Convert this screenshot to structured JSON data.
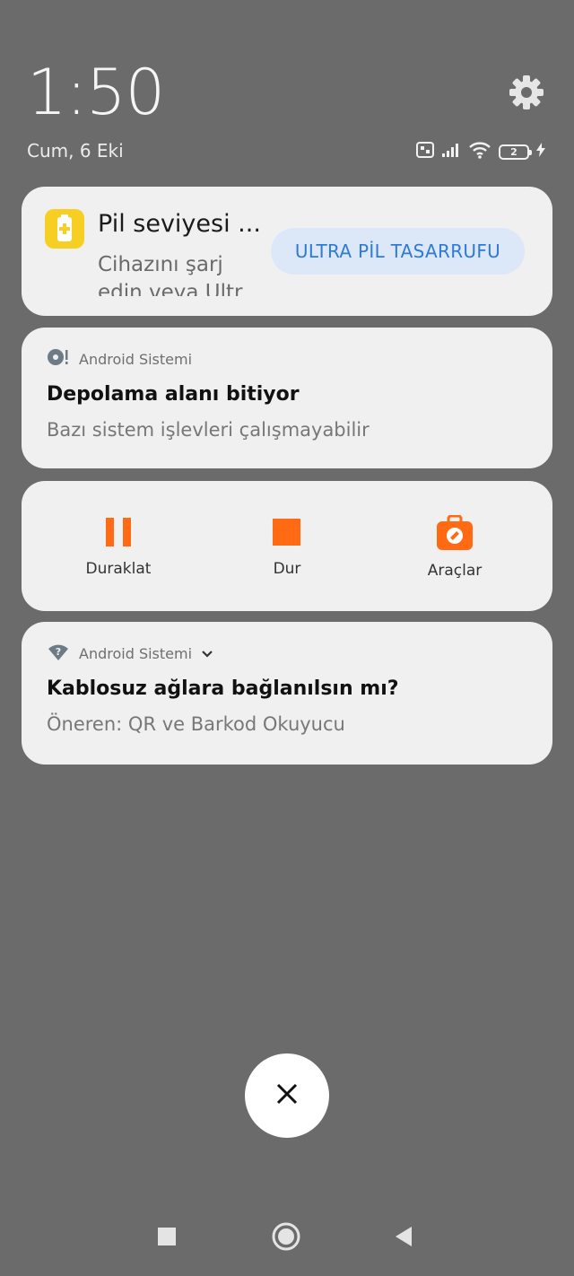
{
  "status": {
    "time": "1:50",
    "date": "Cum, 6 Eki",
    "battery_level": "2",
    "icons": [
      "volte-icon",
      "signal-icon",
      "wifi-icon",
      "battery-icon",
      "charging-icon"
    ]
  },
  "notifications": {
    "battery": {
      "title": "Pil seviyesi ...",
      "body": "Cihazını şarj edin veya Ultr",
      "action": "ULTRA PİL TASARRUFU"
    },
    "storage": {
      "app": "Android Sistemi",
      "title": "Depolama alanı bitiyor",
      "body": "Bazı sistem işlevleri çalışmayabilir"
    },
    "recorder": {
      "pause": "Duraklat",
      "stop": "Dur",
      "tools": "Araçlar"
    },
    "wifi": {
      "app": "Android Sistemi",
      "title": "Kablosuz ağlara bağlanılsın mı?",
      "body": "Öneren: QR ve Barkod Okuyucu"
    }
  },
  "colors": {
    "background": "#6b6b6b",
    "card": "#f0f0f0",
    "accent_orange": "#ff6a13",
    "accent_blue": "#2e7ad8",
    "battery_yellow": "#f6cf22"
  }
}
